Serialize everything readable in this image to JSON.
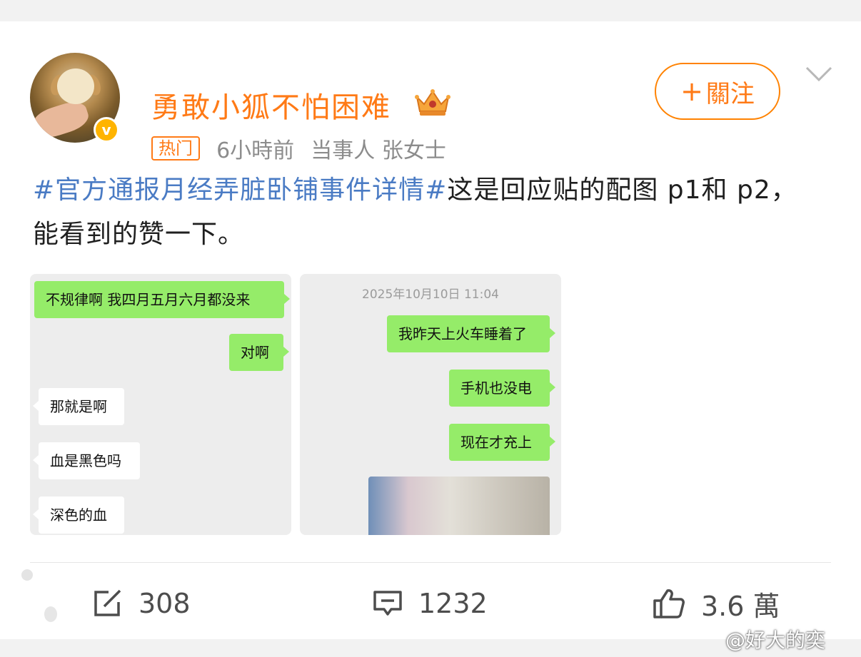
{
  "user": {
    "name": "勇敢小狐不怕困难",
    "verified_badge": "v",
    "hot_tag": "热门",
    "time": "6小時前",
    "source": "当事人 张女士"
  },
  "follow_button": {
    "plus": "+",
    "label": "關注"
  },
  "post": {
    "hashtag": "#官方通报月经弄脏卧铺事件详情#",
    "body": "这是回应贴的配图 p1和 p2，能看到的赞一下。"
  },
  "image1": {
    "messages": [
      {
        "text": "不规律啊 我四月五月六月都没来",
        "side": "right"
      },
      {
        "text": "对啊",
        "side": "right"
      },
      {
        "text": "那就是啊",
        "side": "left"
      },
      {
        "text": "血是黑色吗",
        "side": "left"
      },
      {
        "text": "深色的血",
        "side": "left"
      }
    ]
  },
  "image2": {
    "timestamp": "2025年10月10日 11:04",
    "messages": [
      {
        "text": "我昨天上火车睡着了",
        "side": "right"
      },
      {
        "text": "手机也没电",
        "side": "right"
      },
      {
        "text": "现在才充上",
        "side": "right"
      }
    ]
  },
  "actions": {
    "repost_count": "308",
    "comment_count": "1232",
    "like_count": "3.6 萬"
  },
  "watermark": "@好大的奕",
  "colors": {
    "accent_orange": "#ff7a16",
    "hashtag_blue": "#4a7bc4",
    "wechat_green": "#95ec69"
  }
}
